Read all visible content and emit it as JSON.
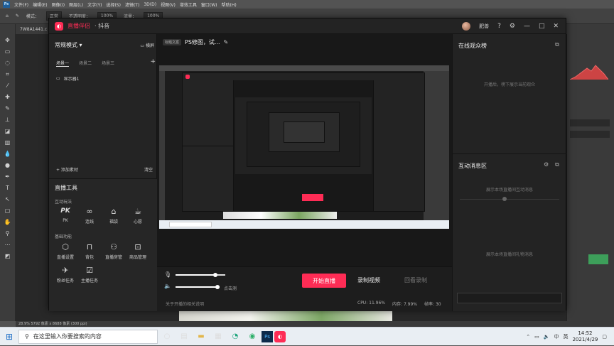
{
  "photoshop": {
    "menu": [
      "文件(F)",
      "编辑(E)",
      "图像(I)",
      "图层(L)",
      "文字(Y)",
      "选择(S)",
      "滤镜(T)",
      "3D(D)",
      "视图(V)",
      "增效工具",
      "窗口(W)",
      "帮助(H)"
    ],
    "options": [
      "模式：",
      "正常",
      "不透明度：",
      "100%",
      "流量：",
      "100%"
    ],
    "doc_tab": "7W8A1441.c",
    "status": "28.9%   5792 像素 x 8688 像素 (300 ppi)"
  },
  "taskbar": {
    "search_placeholder": "在这里输入你要搜索的内容",
    "time": "14:52",
    "date": "2021/4/29",
    "ime": "中",
    "dictation": "英"
  },
  "app": {
    "name": "直播伴侣",
    "platform": "· 抖音",
    "username": "肥兽",
    "title_icons": [
      "help-icon",
      "settings-icon",
      "minimize-icon",
      "maximize-icon",
      "close-icon"
    ],
    "scene": {
      "mode": "常规模式",
      "layout_toggle": "横屏",
      "tabs": [
        "场景一",
        "场景二",
        "场景三"
      ],
      "add": "+",
      "source_item": "显示器1",
      "add_source": "+ 添加素材",
      "clear": "清空"
    },
    "tools": {
      "title": "直播工具",
      "interactive_label": "互动玩法",
      "interactive": [
        {
          "label": "PK",
          "icon": "pk-icon",
          "glyph": "PK"
        },
        {
          "label": "连线",
          "icon": "link-icon",
          "glyph": "∞"
        },
        {
          "label": "福袋",
          "icon": "gift-bag-icon",
          "glyph": "⌂"
        },
        {
          "label": "心愿",
          "icon": "wish-icon",
          "glyph": "☕"
        }
      ],
      "basic_label": "基础功能",
      "basic": [
        {
          "label": "直播设置",
          "icon": "live-settings-icon",
          "glyph": "⬡"
        },
        {
          "label": "背包",
          "icon": "backpack-icon",
          "glyph": "⊓"
        },
        {
          "label": "直播房管",
          "icon": "room-admin-icon",
          "glyph": "⚇"
        },
        {
          "label": "商品管理",
          "icon": "product-icon",
          "glyph": "⊡"
        },
        {
          "label": "粉丝任务",
          "icon": "fans-task-icon",
          "glyph": "✈"
        },
        {
          "label": "主播任务",
          "icon": "anchor-task-icon",
          "glyph": "☑"
        }
      ]
    },
    "stream": {
      "title_tag": "标题文案",
      "title": "PS修图，试...",
      "mic_level": 0.8,
      "speaker_level": 0.95,
      "speaker_label": "点击测",
      "start_live": "开始直播",
      "record": "录制视频",
      "replay": "回看录制",
      "cpu": "CPU: 11.96%",
      "memory": "内存: 7.99%",
      "bitrate": "帧率: 30",
      "warning": "关于开播的相关说明"
    },
    "right": {
      "audience_title": "在线观众榜",
      "audience_empty": "开播后，榜下展示当前观众",
      "interaction_title": "互动消息区",
      "interaction_empty": "展示本场直播间互动消息",
      "gift_empty": "展示本场直播间礼物消息",
      "chat_placeholder": ""
    }
  },
  "colors": {
    "accent": "#fe2c55"
  }
}
